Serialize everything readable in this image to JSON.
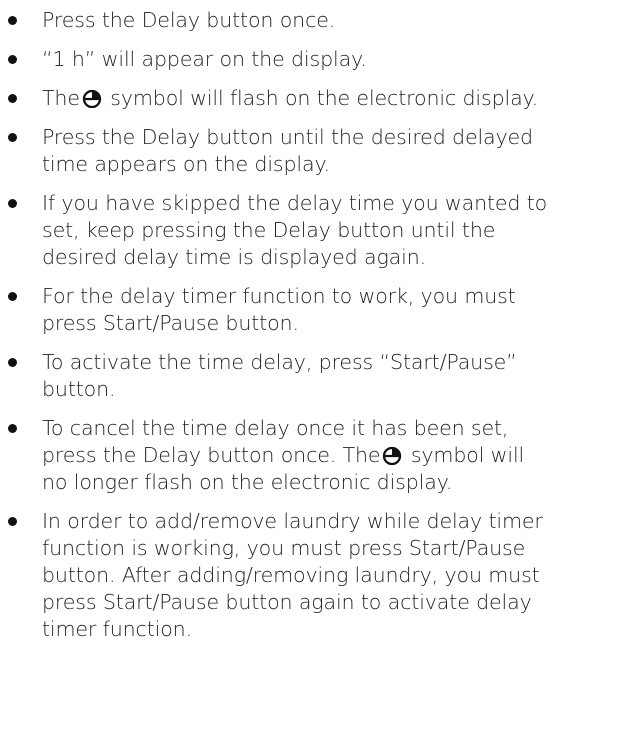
{
  "instructions": [
    {
      "lines": [
        "Press the Delay button once."
      ]
    },
    {
      "lines": [
        "“1 h” will appear on the display."
      ]
    },
    {
      "icon_line": {
        "before": "The",
        "after": "symbol will flash on the electronic display.",
        "icon": "delay-timer-icon"
      }
    },
    {
      "lines": [
        "Press the Delay button until the desired delayed",
        "time appears on the display."
      ]
    },
    {
      "lines": [
        "If you have skipped the delay time you wanted to",
        "set, keep pressing the Delay button until the",
        "desired delay time is displayed again."
      ]
    },
    {
      "lines": [
        "For the delay timer function to work, you must",
        "press Start/Pause button."
      ]
    },
    {
      "lines": [
        "To activate the time delay, press “Start/Pause”",
        "button."
      ]
    },
    {
      "line1": "To cancel the time delay once it has been set,",
      "line2_before": "press the Delay button once. The",
      "line2_after": "symbol will",
      "line3": "no longer flash on the electronic display.",
      "icon": "delay-timer-icon"
    },
    {
      "lines": [
        "In order to add/remove laundry while delay timer",
        "function is working, you must press Start/Pause",
        "button. After adding/removing laundry, you must",
        "press Start/Pause button again to activate delay",
        "timer function."
      ]
    }
  ]
}
